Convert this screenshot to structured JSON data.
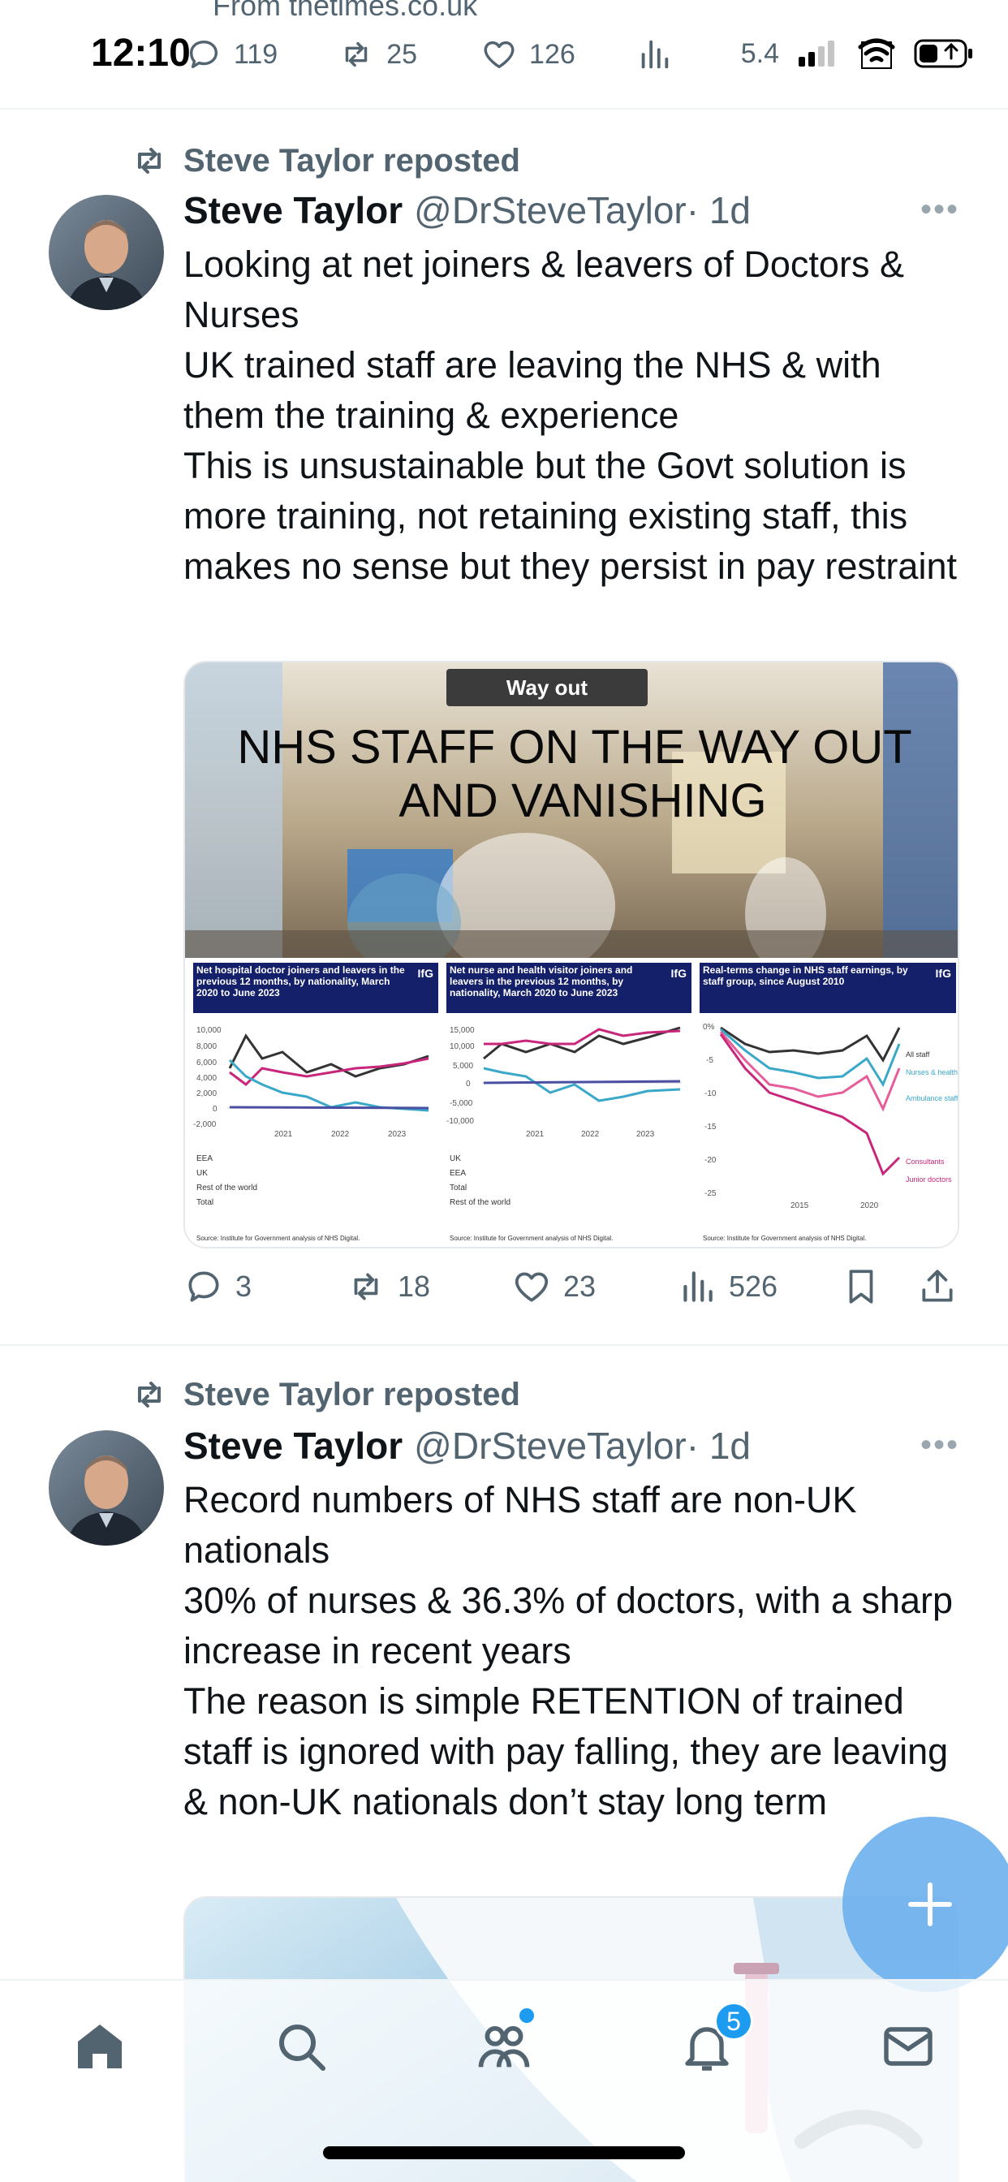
{
  "status_bar": {
    "cutoff_text": "From thetimes.co.uk",
    "time": "12:10",
    "data_speed": "5.4",
    "prev_tweet_actions": {
      "replies": "119",
      "reposts": "25",
      "likes": "126",
      "views": ""
    }
  },
  "tweets": [
    {
      "reposted_by": "Steve Taylor reposted",
      "author_name": "Steve Taylor",
      "author_handle": "@DrSteveTaylor",
      "time_ago": "· 1d",
      "text_lines": [
        "Looking at net joiners & leavers of Doctors & Nurses",
        "UK trained staff are leaving the NHS & with them the training & experience",
        "This is unsustainable but the Govt solution is more training, not retaining existing staff, this makes no sense but they persist in pay restraint"
      ],
      "media": {
        "sign": "Way out",
        "headline_line1": "NHS STAFF ON THE WAY OUT",
        "headline_line2": "AND VANISHING",
        "panels": [
          {
            "title": "Net hospital doctor joiners and leavers in the previous 12 months, by nationality, March 2020 to June 2023",
            "brand": "IfG",
            "y_ticks": [
              "10,000",
              "8,000",
              "6,000",
              "4,000",
              "2,000",
              "0",
              "-2,000"
            ],
            "x_ticks": [
              "2021",
              "2022",
              "2023"
            ],
            "legend": [
              "EEA",
              "UK",
              "Rest of the world",
              "Total"
            ],
            "source": "Source: Institute for Government analysis of NHS Digital."
          },
          {
            "title": "Net nurse and health visitor joiners and leavers in the previous 12 months, by nationality, March 2020 to June 2023",
            "brand": "IfG",
            "y_ticks": [
              "15,000",
              "10,000",
              "5,000",
              "0",
              "-5,000",
              "-10,000"
            ],
            "x_ticks": [
              "2021",
              "2022",
              "2023"
            ],
            "legend": [
              "UK",
              "EEA",
              "Total",
              "Rest of the world"
            ],
            "source": "Source: Institute for Government analysis of NHS Digital."
          },
          {
            "title": "Real-terms change in NHS staff earnings, by staff group, since August 2010",
            "brand": "IfG",
            "y_ticks": [
              "0%",
              "-5",
              "-10",
              "-15",
              "-20",
              "-25"
            ],
            "x_ticks": [
              "2015",
              "2020"
            ],
            "labels": [
              "All staff",
              "Nurses & health visitors",
              "Ambulance staff",
              "Consultants",
              "Junior doctors"
            ],
            "source": "Source: Institute for Government analysis of NHS Digital."
          }
        ]
      },
      "actions": {
        "replies": "3",
        "reposts": "18",
        "likes": "23",
        "views": "526"
      }
    },
    {
      "reposted_by": "Steve Taylor reposted",
      "author_name": "Steve Taylor",
      "author_handle": "@DrSteveTaylor",
      "time_ago": "· 1d",
      "text_lines": [
        "Record numbers of NHS staff are non-UK nationals",
        "30% of nurses & 36.3% of doctors, with a sharp increase in recent years",
        "The reason is simple RETENTION of trained staff is ignored with pay falling, they are leaving & non-UK nationals don’t stay long term"
      ]
    }
  ],
  "bottom_nav": {
    "notifications_badge": "5"
  },
  "colors": {
    "accent": "#1d9bf0",
    "muted": "#536471",
    "text": "#0f1419"
  }
}
